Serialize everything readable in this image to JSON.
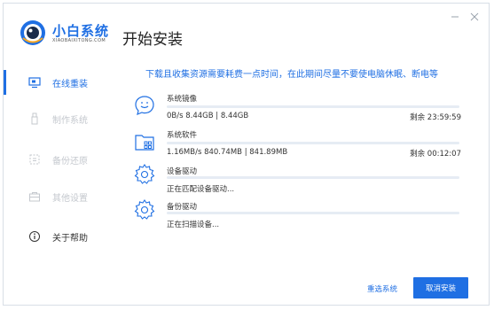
{
  "app": {
    "logo_title": "小白系统",
    "logo_subtitle": "XIAOBAIXITONG.COM",
    "accent_color": "#1f6fe3"
  },
  "window_controls": {
    "minimize_icon": "minimize-icon",
    "close_icon": "close-icon"
  },
  "sidebar": {
    "items": [
      {
        "label": "在线重装",
        "icon": "monitor-icon",
        "state": "active"
      },
      {
        "label": "制作系统",
        "icon": "usb-drive-icon",
        "state": "inactive"
      },
      {
        "label": "备份还原",
        "icon": "backup-restore-icon",
        "state": "inactive"
      },
      {
        "label": "其他设置",
        "icon": "settings-box-icon",
        "state": "inactive"
      },
      {
        "label": "关于帮助",
        "icon": "info-icon",
        "state": "normal"
      }
    ]
  },
  "main": {
    "title": "开始安装",
    "notice": "下载且收集资源需要耗费一点时间，在此期间尽量不要使电脑休眠、断电等",
    "tasks": [
      {
        "name": "系统镜像",
        "info": "0B/s 8.44GB | 8.44GB",
        "remain": "剩余 23:59:59",
        "icon": "chat-bubble-icon",
        "progress": 0
      },
      {
        "name": "系统软件",
        "info": "1.16MB/s 840.74MB | 841.89MB",
        "remain": "剩余 00:12:07",
        "icon": "folder-apps-icon",
        "progress": 0
      },
      {
        "name": "设备驱动",
        "info": "正在匹配设备驱动...",
        "remain": "",
        "icon": "gear-icon",
        "progress": 0
      },
      {
        "name": "备份驱动",
        "info": "正在扫描设备...",
        "remain": "",
        "icon": "gear-backup-icon",
        "progress": 0
      }
    ]
  },
  "footer": {
    "reselect_label": "重选系统",
    "cancel_label": "取消安装"
  }
}
